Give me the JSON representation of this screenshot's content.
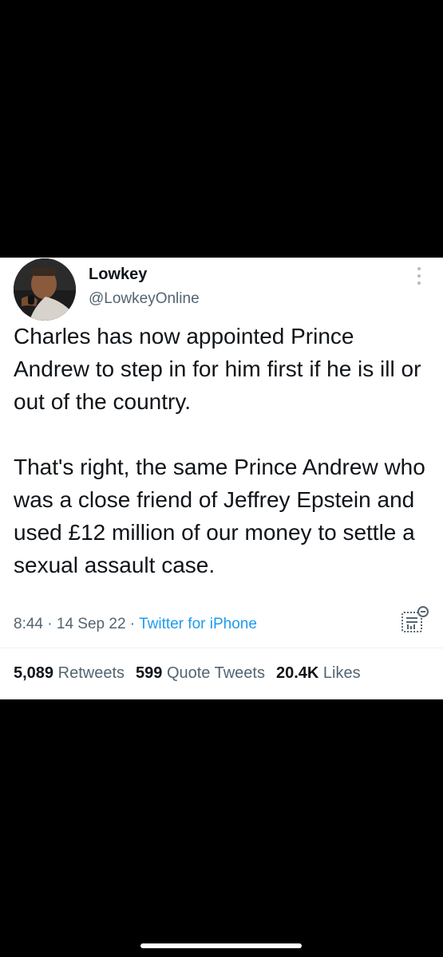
{
  "tweet": {
    "author": {
      "name": "Lowkey",
      "handle": "@LowkeyOnline",
      "avatar_icon": "profile-photo"
    },
    "text": "Charles has now appointed Prince Andrew to step in for him first if he is ill or out of the country.\n\nThat's right, the same Prince Andrew who was a close friend of Jeffrey Epstein and used £12 million of our money to settle a sexual assault case.",
    "time": "8:44",
    "separator": " · ",
    "date": "14 Sep 22",
    "source": "Twitter for iPhone",
    "stats": {
      "retweets_count": "5,089",
      "retweets_label": "Retweets",
      "quotes_count": "599",
      "quotes_label": "Quote Tweets",
      "likes_count": "20.4K",
      "likes_label": "Likes"
    }
  },
  "icons": {
    "more": "more-vertical-icon",
    "analytics": "analytics-icon"
  },
  "colors": {
    "text": "#0f1419",
    "secondary": "#536471",
    "link": "#1d9bf0",
    "background": "#000000",
    "card": "#ffffff"
  }
}
